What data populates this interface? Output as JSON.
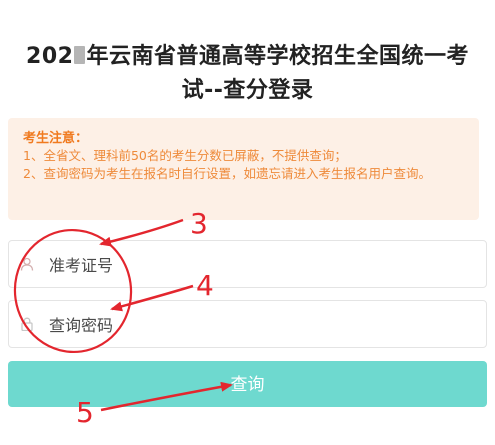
{
  "page": {
    "title_prefix": "202",
    "title_rest": "年云南省普通高等学校招生全国统一考",
    "title_line2": "试--查分登录"
  },
  "notice": {
    "heading": "考生注意：",
    "lines": [
      "1、全省文、理科前50名的考生分数已屏蔽，不提供查询；",
      "2、查询密码为考生在报名时自行设置，如遗忘请进入考生报名用户查询。"
    ]
  },
  "form": {
    "exam_number": {
      "placeholder": "准考证号",
      "icon": "user-icon"
    },
    "password": {
      "placeholder": "查询密码",
      "icon": "lock-icon"
    },
    "submit_label": "查询"
  },
  "annotations": {
    "labels": [
      "3",
      "4",
      "5"
    ],
    "color": "#e3262e"
  },
  "colors": {
    "accent": "#6ed9cf",
    "notice_background": "#fdf0e6",
    "notice_text": "#ee8a3a"
  }
}
